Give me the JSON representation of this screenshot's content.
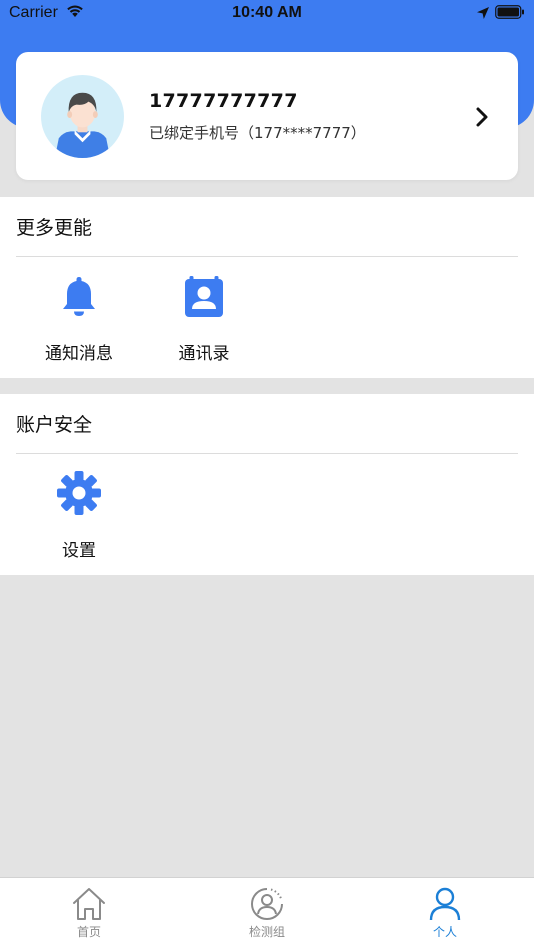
{
  "status_bar": {
    "carrier": "Carrier",
    "time": "10:40 AM"
  },
  "colors": {
    "primary": "#3d7cf1",
    "tab_active": "#1b7fd6",
    "background": "#e3e3e3"
  },
  "profile": {
    "phone": "17777777777",
    "subtitle": "已绑定手机号（177****7777）"
  },
  "sections": [
    {
      "title": "更多更能",
      "items": [
        {
          "label": "通知消息",
          "icon": "bell-icon"
        },
        {
          "label": "通讯录",
          "icon": "contacts-icon"
        }
      ]
    },
    {
      "title": "账户安全",
      "items": [
        {
          "label": "设置",
          "icon": "gear-icon"
        }
      ]
    }
  ],
  "tab_bar": {
    "tabs": [
      {
        "label": "首页",
        "icon": "home-icon",
        "active": false
      },
      {
        "label": "检测组",
        "icon": "user-circle-icon",
        "active": false
      },
      {
        "label": "个人",
        "icon": "person-icon",
        "active": true
      }
    ]
  }
}
